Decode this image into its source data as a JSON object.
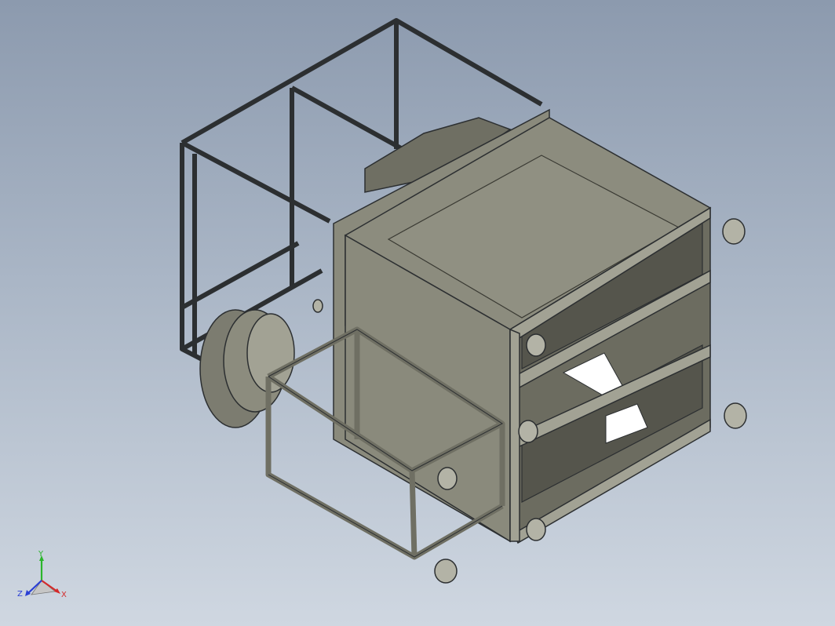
{
  "viewport": {
    "background_top": "#8c9aae",
    "background_bottom": "#cfd7e1"
  },
  "model": {
    "frame_color": "#2c2f31",
    "panel_color": "#8a8a7c",
    "panel_dark": "#55554c",
    "panel_light": "#a2a294",
    "rail_color": "#6f6f63",
    "window_color": "#ffffff",
    "flange_color": "#7c7c70"
  },
  "triad": {
    "x_label": "X",
    "y_label": "Y",
    "z_label": "Z",
    "x_color": "#d42a2a",
    "y_color": "#2bb52b",
    "z_color": "#2a3fd4"
  }
}
